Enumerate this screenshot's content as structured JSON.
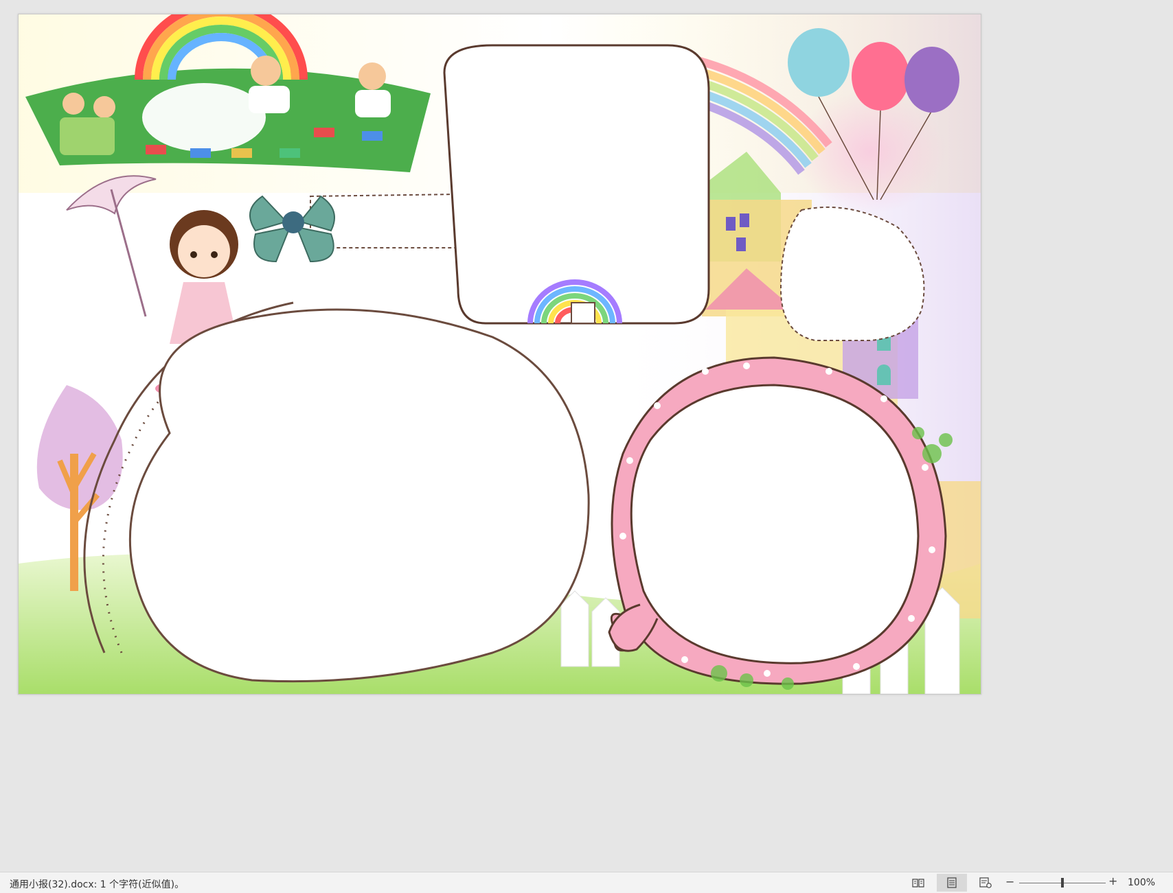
{
  "document": {
    "kind": "handwritten-newspaper template page with blank frames",
    "colors": {
      "rainbow": [
        "#ff5c5c",
        "#ffb347",
        "#ffe34d",
        "#7cd67c",
        "#6db6ff",
        "#a57cff"
      ],
      "pink_frame": "#f6a9c0",
      "frame_outline": "#5a3a2e",
      "balloons": [
        "#8fd4e0",
        "#ff6f91",
        "#9b6fc4"
      ]
    }
  },
  "status_bar": {
    "doc_status": "通用小报(32).docx: 1 个字符(近似值)。",
    "views": [
      {
        "name": "read-mode",
        "icon": "book-icon",
        "active": false
      },
      {
        "name": "print-layout",
        "icon": "page-layout-icon",
        "active": true
      },
      {
        "name": "web-layout",
        "icon": "web-layout-icon",
        "active": false
      }
    ],
    "zoom_minus": "−",
    "zoom_plus": "+",
    "zoom_level": "100%",
    "zoom_fraction": 0.5
  }
}
